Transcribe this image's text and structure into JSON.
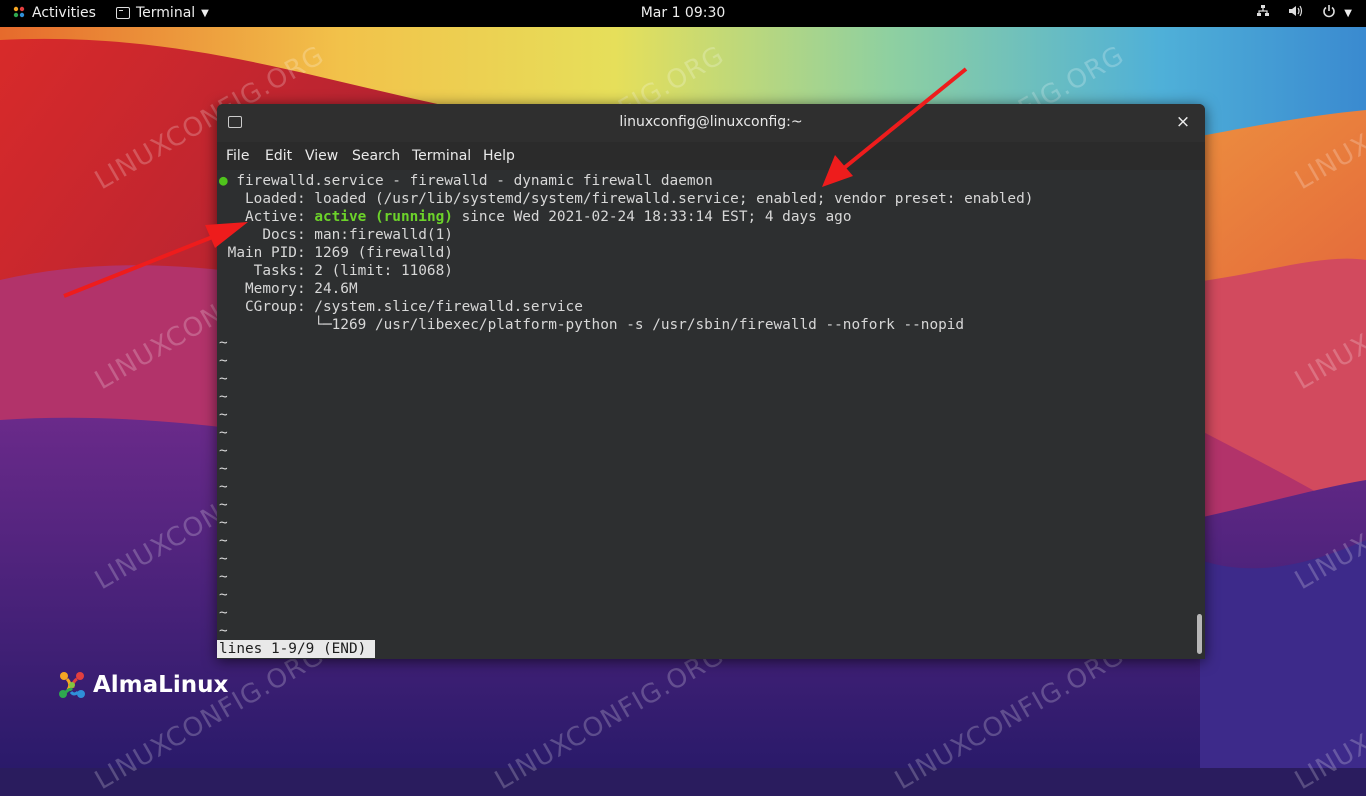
{
  "topbar": {
    "activities": "Activities",
    "app_menu": "Terminal",
    "clock": "Mar 1  09:30",
    "tray_icons": [
      "network-icon",
      "volume-icon",
      "power-icon"
    ]
  },
  "window": {
    "title": "linuxconfig@linuxconfig:~",
    "close": "×",
    "menu": [
      "File",
      "Edit",
      "View",
      "Search",
      "Terminal",
      "Help"
    ]
  },
  "terminal": {
    "dot": "●",
    "lines": [
      " firewalld.service - firewalld - dynamic firewall daemon",
      "   Loaded: loaded (/usr/lib/systemd/system/firewalld.service; enabled; vendor preset: enabled)",
      "   Active: ",
      "active (running)",
      " since Wed 2021-02-24 18:33:14 EST; 4 days ago",
      "     Docs: man:firewalld(1)",
      " Main PID: 1269 (firewalld)",
      "    Tasks: 2 (limit: 11068)",
      "   Memory: 24.6M",
      "   CGroup: /system.slice/firewalld.service",
      "           └─1269 /usr/libexec/platform-python -s /usr/sbin/firewalld --nofork --nopid"
    ],
    "tilde": "~",
    "pager_status": "lines 1-9/9 (END)"
  },
  "watermark": "LINUXCONFIG.ORG",
  "logo": {
    "text": "AlmaLinux"
  },
  "colors": {
    "status_green": "#6cd32a",
    "arrow_red": "#ee1c1c",
    "terminal_bg": "#2d2f30"
  }
}
